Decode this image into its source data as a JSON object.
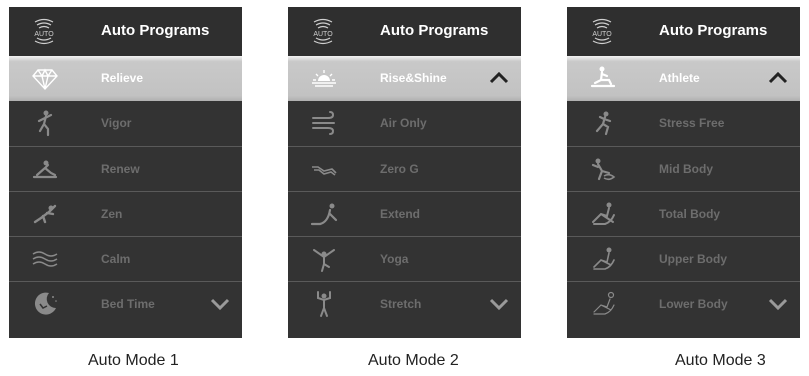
{
  "colors": {
    "panel_bg": "#333333",
    "selected_bg": "#c4c4c4",
    "label_inactive": "#6d6d6d",
    "label_active": "#ffffff",
    "icon_color": "#8a8a8a"
  },
  "panels": [
    {
      "header": {
        "icon": "auto-icon",
        "icon_text": "AUTO",
        "title": "Auto Programs"
      },
      "caption": "Auto Mode 1",
      "items": [
        {
          "label": "Relieve",
          "icon": "diamond-icon",
          "selected": true
        },
        {
          "label": "Vigor",
          "icon": "vigor-figure-icon"
        },
        {
          "label": "Renew",
          "icon": "renew-figure-icon"
        },
        {
          "label": "Zen",
          "icon": "zen-figure-icon"
        },
        {
          "label": "Calm",
          "icon": "waves-icon"
        },
        {
          "label": "Bed Time",
          "icon": "moon-icon",
          "chevron": "chevron-down-icon"
        }
      ]
    },
    {
      "header": {
        "icon": "auto-icon",
        "icon_text": "AUTO",
        "title": "Auto Programs"
      },
      "caption": "Auto Mode 2",
      "items": [
        {
          "label": "Rise&Shine",
          "icon": "sunrise-icon",
          "selected": true,
          "chevron": "chevron-up-icon"
        },
        {
          "label": "Air Only",
          "icon": "wind-icon"
        },
        {
          "label": "Zero G",
          "icon": "zero-g-icon"
        },
        {
          "label": "Extend",
          "icon": "extend-figure-icon"
        },
        {
          "label": "Yoga",
          "icon": "yoga-figure-icon"
        },
        {
          "label": "Stretch",
          "icon": "stretch-figure-icon",
          "chevron": "chevron-down-icon"
        }
      ]
    },
    {
      "header": {
        "icon": "auto-icon",
        "icon_text": "AUTO",
        "title": "Auto Programs"
      },
      "caption": "Auto Mode 3",
      "items": [
        {
          "label": "Athlete",
          "icon": "athlete-figure-icon",
          "selected": true,
          "chevron": "chevron-up-icon"
        },
        {
          "label": "Stress Free",
          "icon": "stress-free-figure-icon"
        },
        {
          "label": "Mid Body",
          "icon": "mid-body-figure-icon"
        },
        {
          "label": "Total Body",
          "icon": "total-body-chair-icon"
        },
        {
          "label": "Upper Body",
          "icon": "upper-body-chair-icon"
        },
        {
          "label": "Lower Body",
          "icon": "lower-body-chair-icon",
          "chevron": "chevron-down-icon"
        }
      ]
    }
  ]
}
